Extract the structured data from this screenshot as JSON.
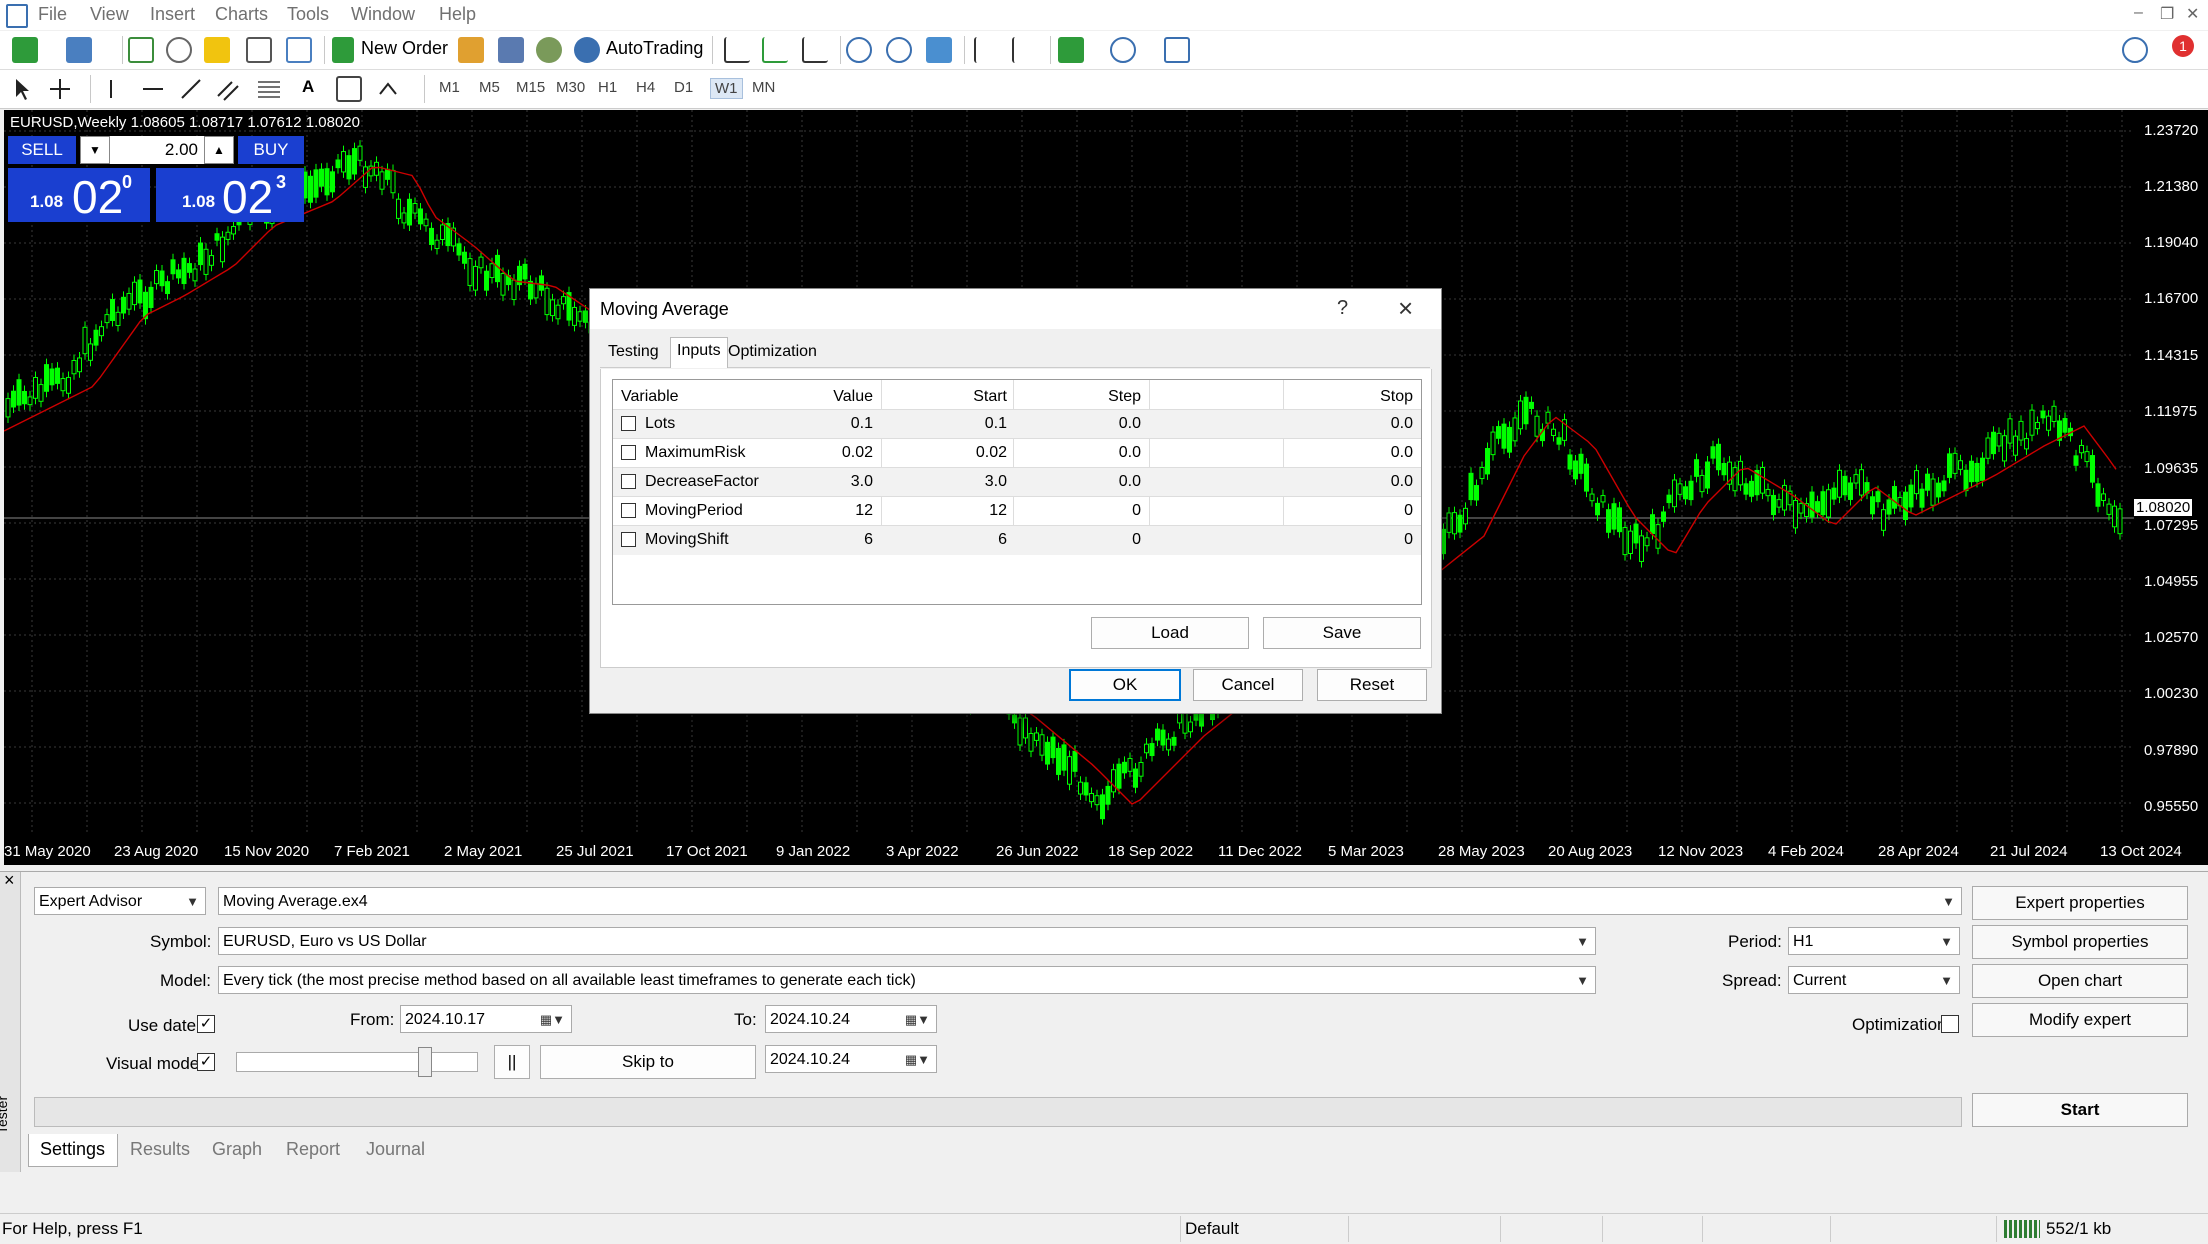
{
  "menu": [
    "File",
    "View",
    "Insert",
    "Charts",
    "Tools",
    "Window",
    "Help"
  ],
  "toolbar": {
    "new_order": "New Order",
    "autotrading": "AutoTrading",
    "notification_count": "1"
  },
  "timeframes": [
    "M1",
    "M5",
    "M15",
    "M30",
    "H1",
    "H4",
    "D1",
    "W1",
    "MN"
  ],
  "active_timeframe": "W1",
  "chart": {
    "title": "EURUSD,Weekly  1.08605 1.08717 1.07612 1.08020",
    "current_price": "1.08020",
    "price_labels": [
      "1.23720",
      "1.21380",
      "1.19040",
      "1.16700",
      "1.14315",
      "1.11975",
      "1.09635",
      "1.08020",
      "1.07295",
      "1.04955",
      "1.02570",
      "1.00230",
      "0.97890",
      "0.95550"
    ],
    "date_labels": [
      "31 May 2020",
      "23 Aug 2020",
      "15 Nov 2020",
      "7 Feb 2021",
      "2 May 2021",
      "25 Jul 2021",
      "17 Oct 2021",
      "9 Jan 2022",
      "3 Apr 2022",
      "26 Jun 2022",
      "18 Sep 2022",
      "11 Dec 2022",
      "5 Mar 2023",
      "28 May 2023",
      "20 Aug 2023",
      "12 Nov 2023",
      "4 Feb 2024",
      "28 Apr 2024",
      "21 Jul 2024",
      "13 Oct 2024"
    ],
    "colors": {
      "candle": "#00ff00",
      "ma": "#cc0000",
      "grid": "#3a3a3a",
      "bg": "#000000"
    }
  },
  "one_click": {
    "sell": "SELL",
    "buy": "BUY",
    "lot": "2.00",
    "sell_prefix": "1.08",
    "sell_big": "02",
    "sell_sup": "0",
    "buy_prefix": "1.08",
    "buy_big": "02",
    "buy_sup": "3"
  },
  "dialog": {
    "title": "Moving Average",
    "help": "?",
    "tabs": [
      "Testing",
      "Inputs",
      "Optimization"
    ],
    "active_tab": "Inputs",
    "columns": [
      "Variable",
      "Value",
      "Start",
      "Step",
      "Stop"
    ],
    "rows": [
      {
        "variable": "Lots",
        "value": "0.1",
        "start": "0.1",
        "step": "0.0",
        "stop": "0.0"
      },
      {
        "variable": "MaximumRisk",
        "value": "0.02",
        "start": "0.02",
        "step": "0.0",
        "stop": "0.0"
      },
      {
        "variable": "DecreaseFactor",
        "value": "3.0",
        "start": "3.0",
        "step": "0.0",
        "stop": "0.0"
      },
      {
        "variable": "MovingPeriod",
        "value": "12",
        "start": "12",
        "step": "0",
        "stop": "0"
      },
      {
        "variable": "MovingShift",
        "value": "6",
        "start": "6",
        "step": "0",
        "stop": "0"
      }
    ],
    "load": "Load",
    "save": "Save",
    "ok": "OK",
    "cancel": "Cancel",
    "reset": "Reset"
  },
  "tester": {
    "type": "Expert Advisor",
    "expert": "Moving Average.ex4",
    "symbol_label": "Symbol:",
    "symbol": "EURUSD, Euro vs US Dollar",
    "model_label": "Model:",
    "model": "Every tick (the most precise method based on all available least timeframes to generate each tick)",
    "period_label": "Period:",
    "period": "H1",
    "spread_label": "Spread:",
    "spread": "Current",
    "use_date_label": "Use date",
    "from_label": "From:",
    "from": "2024.10.17",
    "to_label": "To:",
    "to": "2024.10.24",
    "visual_label": "Visual mode",
    "skip_to": "Skip to",
    "skip_date": "2024.10.24",
    "optimization_label": "Optimization",
    "pause": "||",
    "buttons": [
      "Expert properties",
      "Symbol properties",
      "Open chart",
      "Modify expert"
    ],
    "start": "Start",
    "tabs": [
      "Settings",
      "Results",
      "Graph",
      "Report",
      "Journal"
    ],
    "side_label": "Tester"
  },
  "status": {
    "help": "For Help, press F1",
    "profile": "Default",
    "traffic": "552/1 kb"
  }
}
